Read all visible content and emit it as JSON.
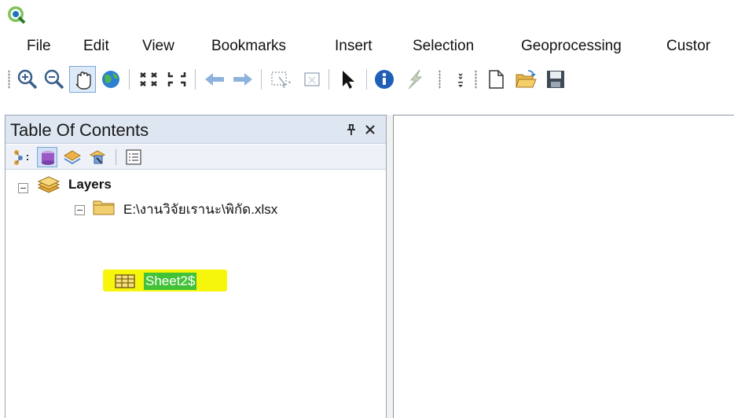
{
  "app": {
    "logo_icon": "qgis-logo-icon",
    "logo_color": "#2a7a2a"
  },
  "menu": {
    "items": [
      "File",
      "Edit",
      "View",
      "Bookmarks",
      "Insert",
      "Selection",
      "Geoprocessing",
      "Custor"
    ]
  },
  "toolbar": {
    "icons": [
      "zoom-in-icon",
      "zoom-out-icon",
      "pan-hand-icon",
      "full-extent-globe-icon",
      "fixed-zoom-in-icon",
      "fixed-zoom-out-icon",
      "back-extent-icon",
      "forward-extent-icon",
      "select-features-icon",
      "clear-selection-icon",
      "select-elements-arrow-icon",
      "identify-info-icon",
      "hyperlink-bolt-icon",
      "new-document-icon",
      "open-folder-icon",
      "save-icon"
    ]
  },
  "toc": {
    "title": "Table Of Contents",
    "pin_icon": "pin-icon",
    "close_icon": "close-icon",
    "tools": [
      "list-by-drawing-order-icon",
      "list-by-source-icon",
      "list-by-visibility-icon",
      "list-by-selection-icon",
      "options-icon"
    ],
    "tree": {
      "root_label": "Layers",
      "source_label": "E:\\งานวิจัยเรานะ\\พิกัด.xlsx",
      "table_label": "Sheet2$"
    }
  },
  "colors": {
    "accent": "#dde6f1",
    "highlight_yellow": "#f6f60d",
    "selection_green": "#42c237"
  }
}
